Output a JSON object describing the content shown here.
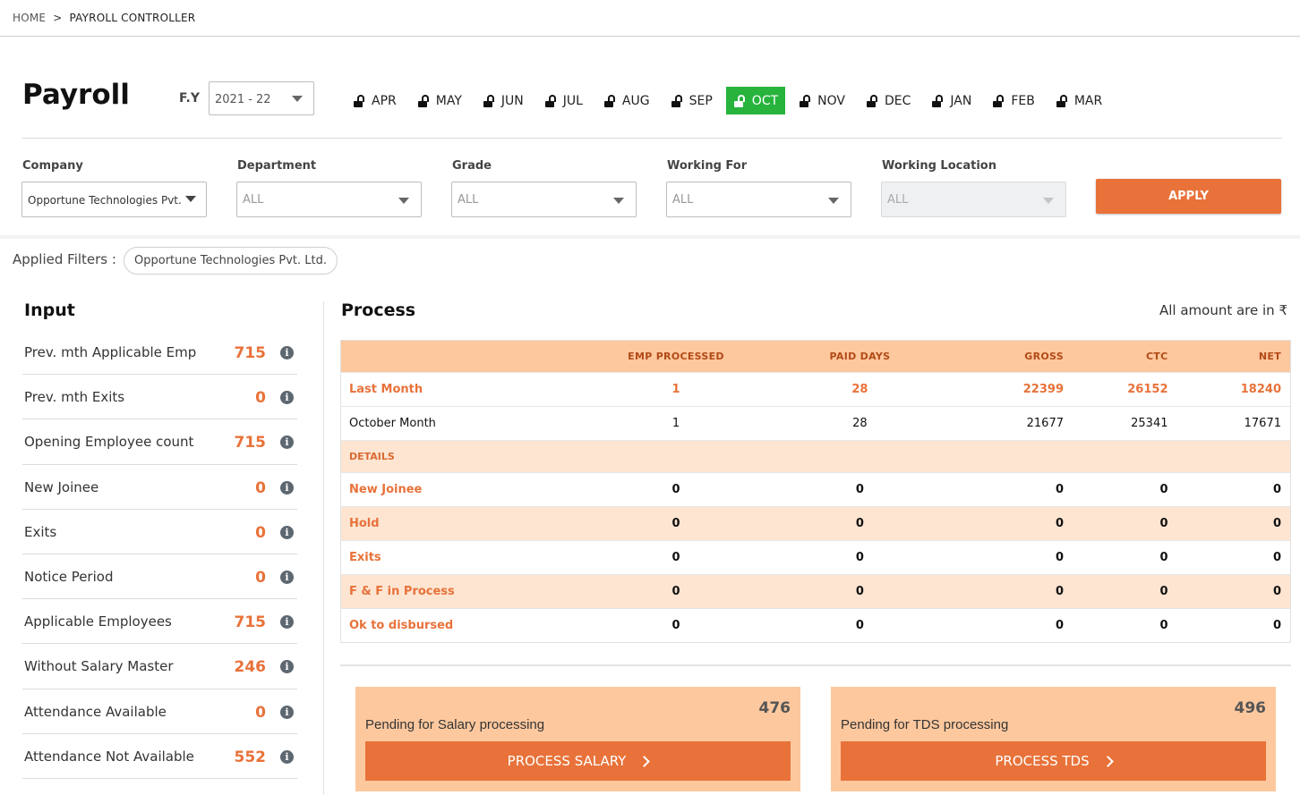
{
  "breadcrumb": {
    "home": "HOME",
    "separator": ">",
    "current": "PAYROLL CONTROLLER"
  },
  "header": {
    "title": "Payroll",
    "fy_label": "F.Y",
    "fy_value": "2021 - 22",
    "months": [
      "APR",
      "MAY",
      "JUN",
      "JUL",
      "AUG",
      "SEP",
      "OCT",
      "NOV",
      "DEC",
      "JAN",
      "FEB",
      "MAR"
    ],
    "active_month": "OCT"
  },
  "filters": {
    "company": {
      "label": "Company",
      "value": "Opportune Technologies Pvt. Ltd."
    },
    "department": {
      "label": "Department",
      "value": "ALL"
    },
    "grade": {
      "label": "Grade",
      "value": "ALL"
    },
    "working_for": {
      "label": "Working For",
      "value": "ALL"
    },
    "working_location": {
      "label": "Working Location",
      "value": "ALL"
    },
    "apply_label": "APPLY"
  },
  "applied_filters": {
    "label": "Applied Filters :",
    "chips": [
      "Opportune Technologies Pvt. Ltd."
    ]
  },
  "input": {
    "title": "Input",
    "rows": [
      {
        "label": "Prev. mth Applicable Emp",
        "value": "715"
      },
      {
        "label": "Prev. mth Exits",
        "value": "0"
      },
      {
        "label": "Opening Employee count",
        "value": "715"
      },
      {
        "label": "New Joinee",
        "value": "0"
      },
      {
        "label": "Exits",
        "value": "0"
      },
      {
        "label": "Notice Period",
        "value": "0"
      },
      {
        "label": "Applicable Employees",
        "value": "715"
      },
      {
        "label": "Without Salary Master",
        "value": "246"
      },
      {
        "label": "Attendance Available",
        "value": "0"
      },
      {
        "label": "Attendance Not Available",
        "value": "552"
      }
    ]
  },
  "process": {
    "title": "Process",
    "amount_note": "All amount are in ₹",
    "columns": [
      "",
      "EMP PROCESSED",
      "PAID DAYS",
      "GROSS",
      "CTC",
      "NET"
    ],
    "last_month": [
      "Last Month",
      "1",
      "28",
      "22399",
      "26152",
      "18240"
    ],
    "october_month": [
      "October Month",
      "1",
      "28",
      "21677",
      "25341",
      "17671"
    ],
    "details_label": "DETAILS",
    "details": [
      [
        "New Joinee",
        "0",
        "0",
        "0",
        "0",
        "0"
      ],
      [
        "Hold",
        "0",
        "0",
        "0",
        "0",
        "0"
      ],
      [
        "Exits",
        "0",
        "0",
        "0",
        "0",
        "0"
      ],
      [
        "F & F in Process",
        "0",
        "0",
        "0",
        "0",
        "0"
      ],
      [
        "Ok to disbursed",
        "0",
        "0",
        "0",
        "0",
        "0"
      ]
    ]
  },
  "pending": {
    "salary": {
      "count": "476",
      "text": "Pending for Salary processing",
      "button": "PROCESS SALARY"
    },
    "tds": {
      "count": "496",
      "text": "Pending for TDS processing",
      "button": "PROCESS TDS"
    }
  },
  "colors": {
    "accent": "#e8723a",
    "active_month": "#27b33c",
    "table_header": "#fdc89e",
    "table_shade": "#fde5d2"
  }
}
